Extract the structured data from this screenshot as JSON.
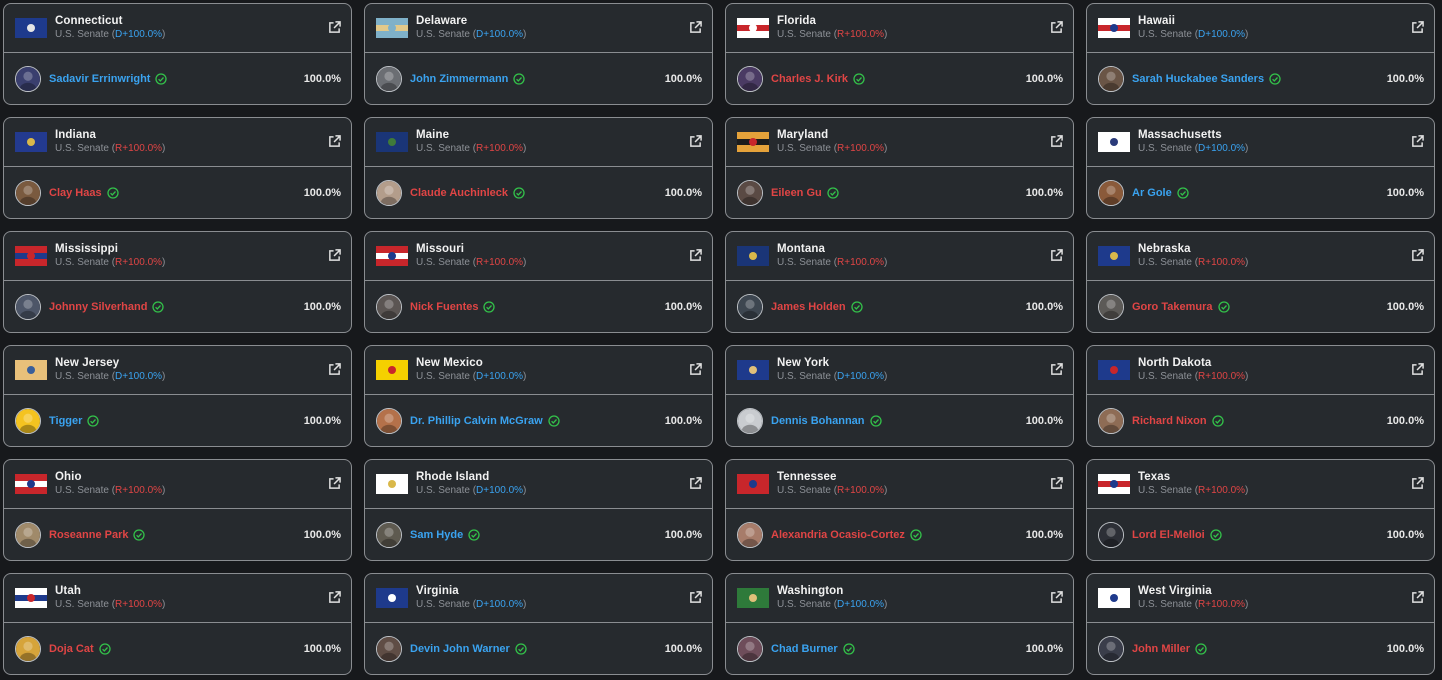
{
  "colors": {
    "dem": "#3aa3f0",
    "rep": "#e04545",
    "check": "#33c24a",
    "border": "#8a8d91",
    "card_bg": "#262a2e"
  },
  "icons": {
    "external_link": "external-link-icon",
    "check": "check-circle-icon"
  },
  "races": [
    {
      "state": "Connecticut",
      "race_prefix": "U.S. Senate (",
      "party": "D",
      "margin": "+100.0%",
      "race_suffix": ")",
      "candidate": "Sadavir Errinwright",
      "pct": "100.0%",
      "flag": [
        "#1e3a8c",
        "#1e3a8c",
        "#e6e6e6"
      ],
      "avatar": "#3a3f6e"
    },
    {
      "state": "Delaware",
      "race_prefix": "U.S. Senate (",
      "party": "D",
      "margin": "+100.0%",
      "race_suffix": ")",
      "candidate": "John Zimmermann",
      "pct": "100.0%",
      "flag": [
        "#7fb1c9",
        "#e2c98a",
        "#7fb1c9"
      ],
      "avatar": "#6b6e73"
    },
    {
      "state": "Florida",
      "race_prefix": "U.S. Senate (",
      "party": "R",
      "margin": "+100.0%",
      "race_suffix": ")",
      "candidate": "Charles J. Kirk",
      "pct": "100.0%",
      "flag": [
        "#ffffff",
        "#c8262b",
        "#ffffff"
      ],
      "avatar": "#4a3a63"
    },
    {
      "state": "Hawaii",
      "race_prefix": "U.S. Senate (",
      "party": "D",
      "margin": "+100.0%",
      "race_suffix": ")",
      "candidate": "Sarah Huckabee Sanders",
      "pct": "100.0%",
      "flag": [
        "#ffffff",
        "#c8262b",
        "#1e3a8c"
      ],
      "avatar": "#6a5546"
    },
    {
      "state": "Indiana",
      "race_prefix": "U.S. Senate (",
      "party": "R",
      "margin": "+100.0%",
      "race_suffix": ")",
      "candidate": "Clay Haas",
      "pct": "100.0%",
      "flag": [
        "#233a8f",
        "#233a8f",
        "#d9b84a"
      ],
      "avatar": "#7a5a3f"
    },
    {
      "state": "Maine",
      "race_prefix": "U.S. Senate (",
      "party": "R",
      "margin": "+100.0%",
      "race_suffix": ")",
      "candidate": "Claude Auchinleck",
      "pct": "100.0%",
      "flag": [
        "#1a3577",
        "#1a3577",
        "#3f7a3a"
      ],
      "avatar": "#b39d8b"
    },
    {
      "state": "Maryland",
      "race_prefix": "U.S. Senate (",
      "party": "R",
      "margin": "+100.0%",
      "race_suffix": ")",
      "candidate": "Eileen Gu",
      "pct": "100.0%",
      "flag": [
        "#e5a23a",
        "#1c1c1c",
        "#c8262b"
      ],
      "avatar": "#5a4a44"
    },
    {
      "state": "Massachusetts",
      "race_prefix": "U.S. Senate (",
      "party": "D",
      "margin": "+100.0%",
      "race_suffix": ")",
      "candidate": "Ar Gole",
      "pct": "100.0%",
      "flag": [
        "#ffffff",
        "#ffffff",
        "#2a3b7a"
      ],
      "avatar": "#8a5a3a"
    },
    {
      "state": "Mississippi",
      "race_prefix": "U.S. Senate (",
      "party": "R",
      "margin": "+100.0%",
      "race_suffix": ")",
      "candidate": "Johnny Silverhand",
      "pct": "100.0%",
      "flag": [
        "#c8262b",
        "#1e3a8c",
        "#c8262b"
      ],
      "avatar": "#4d5668"
    },
    {
      "state": "Missouri",
      "race_prefix": "U.S. Senate (",
      "party": "R",
      "margin": "+100.0%",
      "race_suffix": ")",
      "candidate": "Nick Fuentes",
      "pct": "100.0%",
      "flag": [
        "#c8262b",
        "#ffffff",
        "#1e3a8c"
      ],
      "avatar": "#5b5553"
    },
    {
      "state": "Montana",
      "race_prefix": "U.S. Senate (",
      "party": "R",
      "margin": "+100.0%",
      "race_suffix": ")",
      "candidate": "James Holden",
      "pct": "100.0%",
      "flag": [
        "#1a3577",
        "#1a3577",
        "#d9b84a"
      ],
      "avatar": "#3d4650"
    },
    {
      "state": "Nebraska",
      "race_prefix": "U.S. Senate (",
      "party": "R",
      "margin": "+100.0%",
      "race_suffix": ")",
      "candidate": "Goro Takemura",
      "pct": "100.0%",
      "flag": [
        "#1e3a8c",
        "#1e3a8c",
        "#d9b84a"
      ],
      "avatar": "#5c5a57"
    },
    {
      "state": "New Jersey",
      "race_prefix": "U.S. Senate (",
      "party": "D",
      "margin": "+100.0%",
      "race_suffix": ")",
      "candidate": "Tigger",
      "pct": "100.0%",
      "flag": [
        "#e8c07a",
        "#e8c07a",
        "#3a5f9a"
      ],
      "avatar": "#f4c320"
    },
    {
      "state": "New Mexico",
      "race_prefix": "U.S. Senate (",
      "party": "D",
      "margin": "+100.0%",
      "race_suffix": ")",
      "candidate": "Dr. Phillip Calvin McGraw",
      "pct": "100.0%",
      "flag": [
        "#f5d000",
        "#f5d000",
        "#c8262b"
      ],
      "avatar": "#b4714a"
    },
    {
      "state": "New York",
      "race_prefix": "U.S. Senate (",
      "party": "D",
      "margin": "+100.0%",
      "race_suffix": ")",
      "candidate": "Dennis Bohannan",
      "pct": "100.0%",
      "flag": [
        "#1e3a8c",
        "#1e3a8c",
        "#e0c07a"
      ],
      "avatar": "#c9ccd0"
    },
    {
      "state": "North Dakota",
      "race_prefix": "U.S. Senate (",
      "party": "R",
      "margin": "+100.0%",
      "race_suffix": ")",
      "candidate": "Richard Nixon",
      "pct": "100.0%",
      "flag": [
        "#1e3a8c",
        "#1e3a8c",
        "#c8262b"
      ],
      "avatar": "#8e6c55"
    },
    {
      "state": "Ohio",
      "race_prefix": "U.S. Senate (",
      "party": "R",
      "margin": "+100.0%",
      "race_suffix": ")",
      "candidate": "Roseanne Park",
      "pct": "100.0%",
      "flag": [
        "#c8262b",
        "#ffffff",
        "#1e3a8c"
      ],
      "avatar": "#a08a6a"
    },
    {
      "state": "Rhode Island",
      "race_prefix": "U.S. Senate (",
      "party": "D",
      "margin": "+100.0%",
      "race_suffix": ")",
      "candidate": "Sam Hyde",
      "pct": "100.0%",
      "flag": [
        "#ffffff",
        "#ffffff",
        "#d9b84a"
      ],
      "avatar": "#5e5a50"
    },
    {
      "state": "Tennessee",
      "race_prefix": "U.S. Senate (",
      "party": "R",
      "margin": "+100.0%",
      "race_suffix": ")",
      "candidate": "Alexandria Ocasio-Cortez",
      "pct": "100.0%",
      "flag": [
        "#c8262b",
        "#c8262b",
        "#1e3a8c"
      ],
      "avatar": "#a77c6a"
    },
    {
      "state": "Texas",
      "race_prefix": "U.S. Senate (",
      "party": "R",
      "margin": "+100.0%",
      "race_suffix": ")",
      "candidate": "Lord El-Melloi",
      "pct": "100.0%",
      "flag": [
        "#ffffff",
        "#c8262b",
        "#1e3a8c"
      ],
      "avatar": "#2c2f36"
    },
    {
      "state": "Utah",
      "race_prefix": "U.S. Senate (",
      "party": "R",
      "margin": "+100.0%",
      "race_suffix": ")",
      "candidate": "Doja Cat",
      "pct": "100.0%",
      "flag": [
        "#ffffff",
        "#1e3a8c",
        "#c8262b"
      ],
      "avatar": "#d6a43a"
    },
    {
      "state": "Virginia",
      "race_prefix": "U.S. Senate (",
      "party": "D",
      "margin": "+100.0%",
      "race_suffix": ")",
      "candidate": "Devin John Warner",
      "pct": "100.0%",
      "flag": [
        "#1e3a8c",
        "#1e3a8c",
        "#ffffff"
      ],
      "avatar": "#5f4d45"
    },
    {
      "state": "Washington",
      "race_prefix": "U.S. Senate (",
      "party": "D",
      "margin": "+100.0%",
      "race_suffix": ")",
      "candidate": "Chad Burner",
      "pct": "100.0%",
      "flag": [
        "#2e7a3a",
        "#2e7a3a",
        "#e0c07a"
      ],
      "avatar": "#6e4d5a"
    },
    {
      "state": "West Virginia",
      "race_prefix": "U.S. Senate (",
      "party": "R",
      "margin": "+100.0%",
      "race_suffix": ")",
      "candidate": "John Miller",
      "pct": "100.0%",
      "flag": [
        "#ffffff",
        "#ffffff",
        "#1e3a8c"
      ],
      "avatar": "#3a3d4a"
    }
  ]
}
